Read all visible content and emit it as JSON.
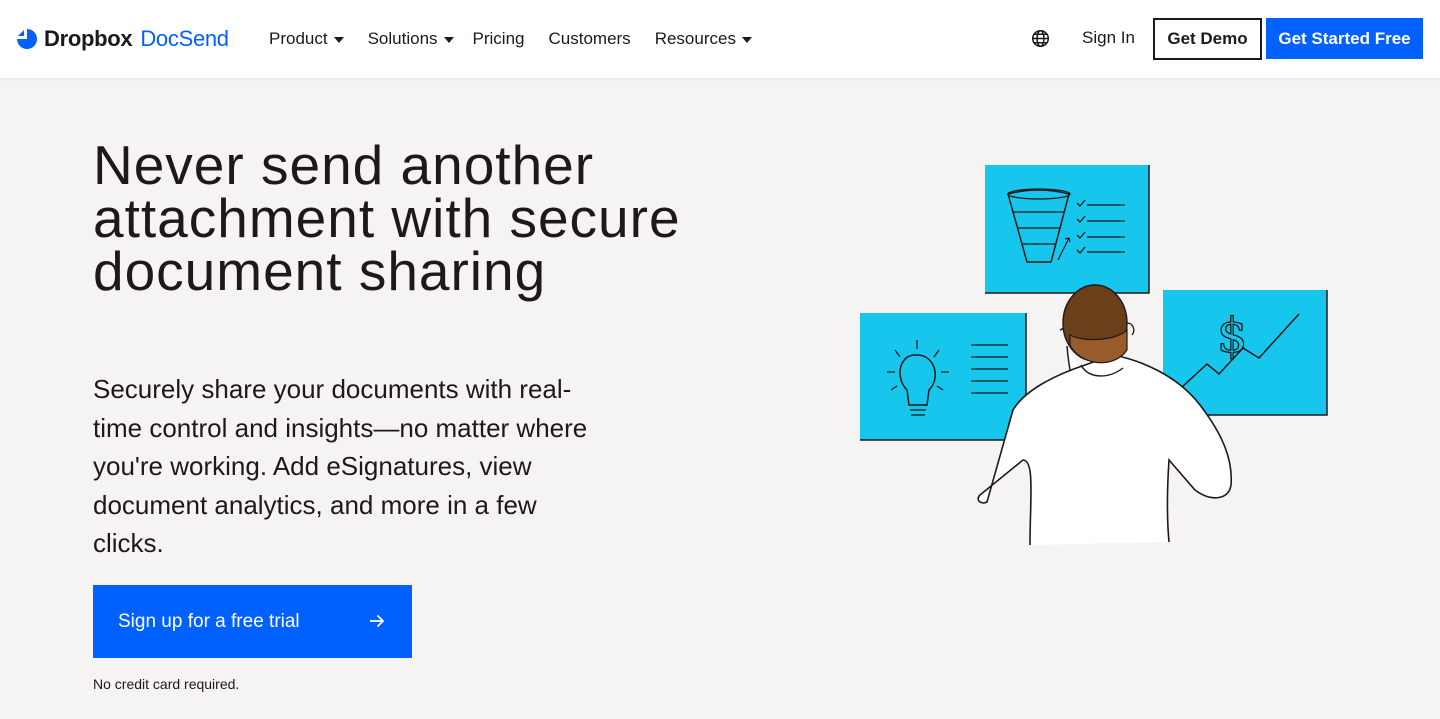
{
  "nav": {
    "logo_brand": "Dropbox",
    "logo_product": "DocSend",
    "items": [
      {
        "label": "Product",
        "has_dropdown": true
      },
      {
        "label": "Solutions",
        "has_dropdown": true
      },
      {
        "label": "Pricing",
        "has_dropdown": false
      },
      {
        "label": "Customers",
        "has_dropdown": false
      },
      {
        "label": "Resources",
        "has_dropdown": true
      }
    ],
    "language_icon": "globe-icon",
    "signin_label": "Sign In",
    "demo_label": "Get Demo",
    "start_label": "Get Started Free"
  },
  "hero": {
    "title": "Never send another attachment with secure document sharing",
    "subtitle": "Securely share your documents with real-time control and insights—no matter where you're working. Add eSignatures, view document analytics, and more in a few clicks.",
    "cta_label": "Sign up for a free trial",
    "cta_icon": "arrow-right-icon",
    "note": "No credit card required."
  },
  "colors": {
    "accent": "#0061fe",
    "background": "#f5f4f2",
    "panel": "#16c6ed",
    "text": "#1e1919"
  }
}
